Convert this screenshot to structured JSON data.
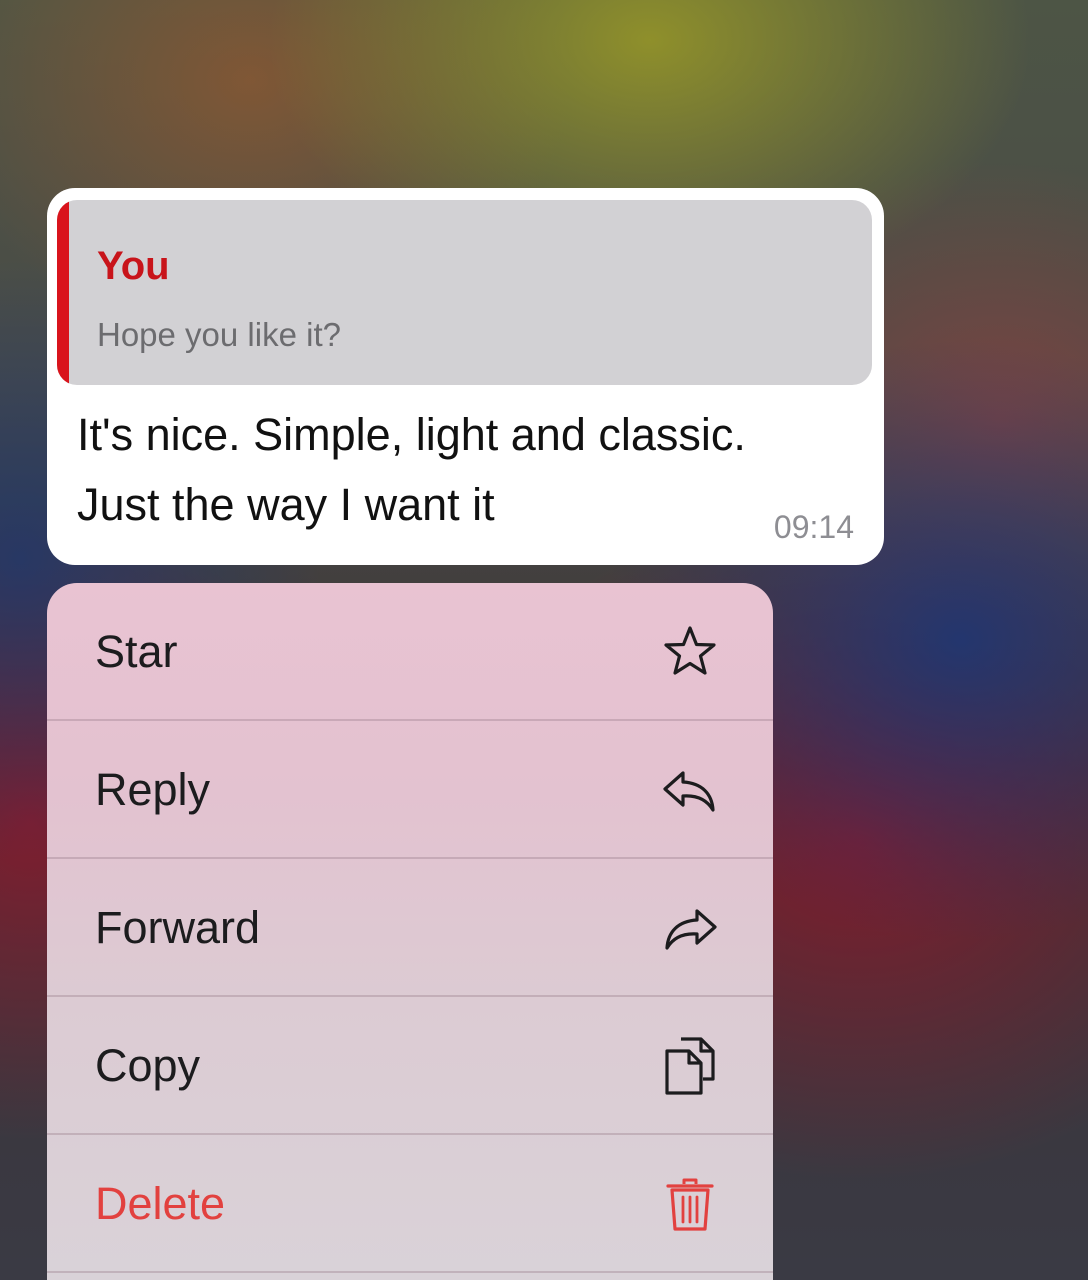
{
  "quoted_message": {
    "author": "You",
    "text": "Hope you like it?",
    "accent_color": "#d9141c"
  },
  "message": {
    "lines": [
      "It's nice. Simple, light and classic.",
      "Just the way I want it"
    ],
    "time": "09:14"
  },
  "menu": {
    "items": [
      {
        "label": "Star",
        "icon": "star-icon"
      },
      {
        "label": "Reply",
        "icon": "reply-icon"
      },
      {
        "label": "Forward",
        "icon": "forward-icon"
      },
      {
        "label": "Copy",
        "icon": "copy-icon"
      },
      {
        "label": "Delete",
        "icon": "trash-icon",
        "color": "#e2413f"
      }
    ]
  }
}
